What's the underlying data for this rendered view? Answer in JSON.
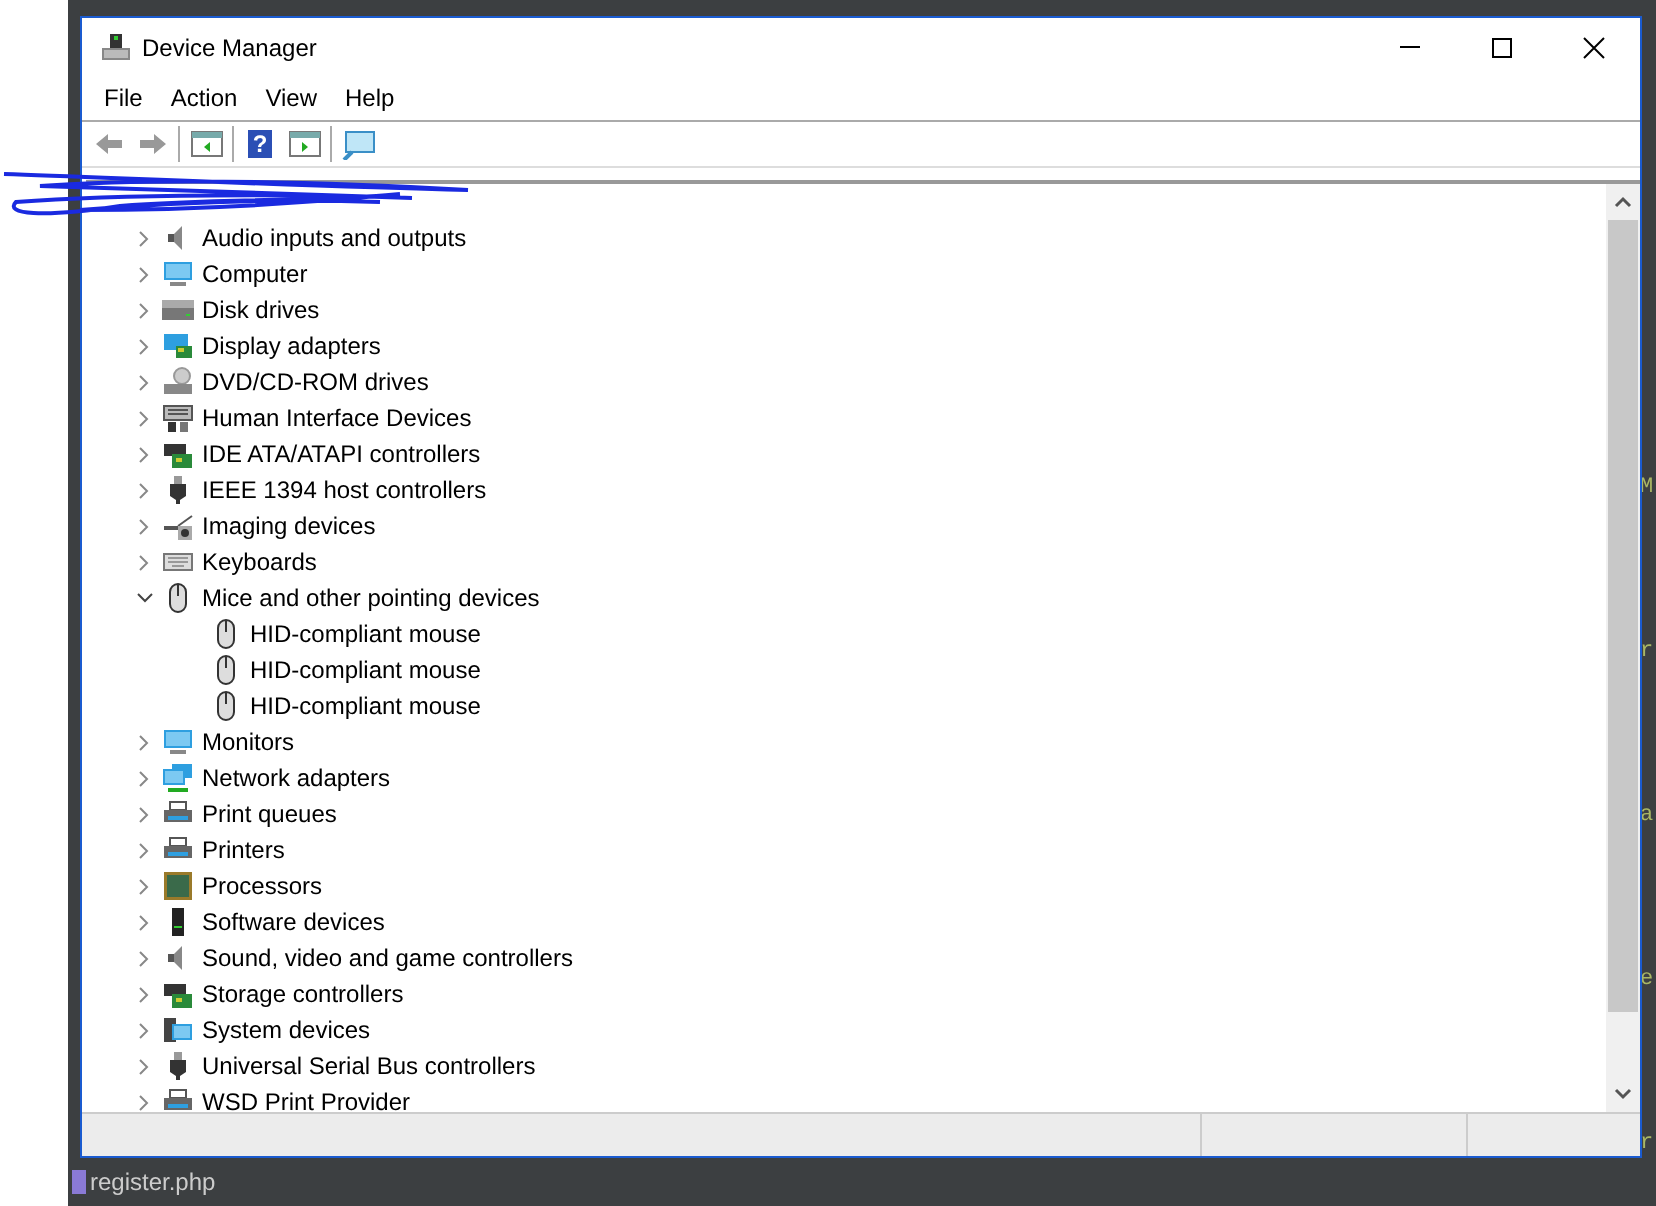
{
  "ide_file_tab": "register.php",
  "ide_code_fragments": [
    "M",
    "r",
    "a",
    "e",
    "r"
  ],
  "window": {
    "title": "Device Manager"
  },
  "menu": [
    "File",
    "Action",
    "View",
    "Help"
  ],
  "toolbar": [
    {
      "kind": "back",
      "disabled": true
    },
    {
      "kind": "forward",
      "disabled": true
    },
    {
      "kind": "separator"
    },
    {
      "kind": "tree"
    },
    {
      "kind": "separator"
    },
    {
      "kind": "help",
      "glyph": "?"
    },
    {
      "kind": "panel"
    },
    {
      "kind": "separator"
    },
    {
      "kind": "scan"
    }
  ],
  "tree": [
    {
      "label": "Audio inputs and outputs",
      "kind": "speaker",
      "expanded": false
    },
    {
      "label": "Computer",
      "kind": "monitor",
      "expanded": false
    },
    {
      "label": "Disk drives",
      "kind": "drive",
      "expanded": false
    },
    {
      "label": "Display adapters",
      "kind": "display",
      "expanded": false
    },
    {
      "label": "DVD/CD-ROM drives",
      "kind": "disc",
      "expanded": false
    },
    {
      "label": "Human Interface Devices",
      "kind": "hid",
      "expanded": false
    },
    {
      "label": "IDE ATA/ATAPI controllers",
      "kind": "card",
      "expanded": false
    },
    {
      "label": "IEEE 1394 host controllers",
      "kind": "plug",
      "expanded": false
    },
    {
      "label": "Imaging devices",
      "kind": "camera",
      "expanded": false
    },
    {
      "label": "Keyboards",
      "kind": "keyboard",
      "expanded": false
    },
    {
      "label": "Mice and other pointing devices",
      "kind": "mouse",
      "expanded": true,
      "children": [
        {
          "label": "HID-compliant mouse",
          "kind": "mouse"
        },
        {
          "label": "HID-compliant mouse",
          "kind": "mouse"
        },
        {
          "label": "HID-compliant mouse",
          "kind": "mouse"
        }
      ]
    },
    {
      "label": "Monitors",
      "kind": "monitor",
      "expanded": false
    },
    {
      "label": "Network adapters",
      "kind": "network",
      "expanded": false
    },
    {
      "label": "Print queues",
      "kind": "printer",
      "expanded": false
    },
    {
      "label": "Printers",
      "kind": "printer",
      "expanded": false
    },
    {
      "label": "Processors",
      "kind": "chip",
      "expanded": false
    },
    {
      "label": "Software devices",
      "kind": "tower",
      "expanded": false
    },
    {
      "label": "Sound, video and game controllers",
      "kind": "speaker",
      "expanded": false
    },
    {
      "label": "Storage controllers",
      "kind": "card",
      "expanded": false
    },
    {
      "label": "System devices",
      "kind": "system",
      "expanded": false
    },
    {
      "label": "Universal Serial Bus controllers",
      "kind": "plug",
      "expanded": false
    },
    {
      "label": "WSD Print Provider",
      "kind": "printer",
      "expanded": false
    }
  ]
}
